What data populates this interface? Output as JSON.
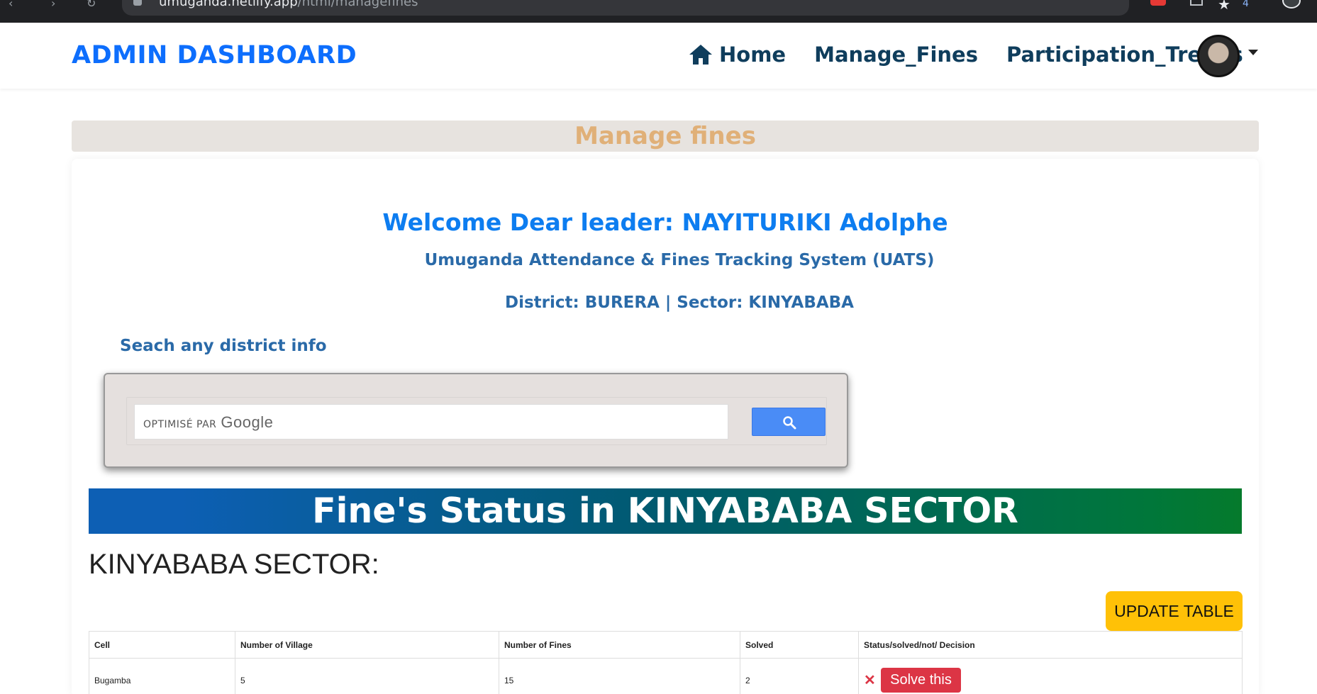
{
  "browser": {
    "url_host": "umuganda.netlify.app",
    "url_path": "/html/managefines",
    "extension_count": "4"
  },
  "navbar": {
    "brand": "ADMIN DASHBOARD",
    "links": [
      {
        "label": "Home",
        "icon": "home-icon"
      },
      {
        "label": "Manage_Fines"
      },
      {
        "label": "Participation_Trends"
      }
    ]
  },
  "page": {
    "title": "Manage fines",
    "welcome": "Welcome Dear leader: NAYITURIKI Adolphe",
    "subtitle": "Umuganda Attendance & Fines Tracking System (UATS)",
    "district_line": "District: BURERA | Sector: KINYABABA",
    "search_label": "Seach any district info"
  },
  "search": {
    "powered_by": "OPTIMISÉ PAR",
    "google": "Google"
  },
  "status": {
    "banner": "Fine's Status in KINYABABA SECTOR",
    "sector_heading": "KINYABABA SECTOR:",
    "update_button": "UPDATE TABLE"
  },
  "table": {
    "headers": [
      "Cell",
      "Number of Village",
      "Number of Fines",
      "Solved",
      "Status/solved/not/ Decision"
    ],
    "rows": [
      {
        "cell": "Bugamba",
        "villages": "5",
        "fines": "15",
        "solved": "2",
        "status_mark": "✕",
        "action": "Solve this"
      }
    ]
  },
  "colors": {
    "brand_blue": "#0d6efd",
    "nav_dark": "#0f3d5c",
    "title_orange": "#e0b078",
    "update_yellow": "#ffc107",
    "danger_red": "#dc3545"
  }
}
